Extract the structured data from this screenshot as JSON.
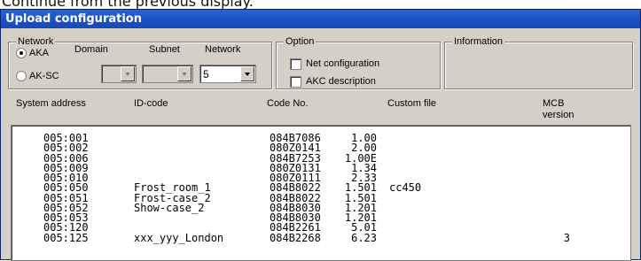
{
  "caption": "Continue from the previous display.",
  "window": {
    "title": "Upload configuration"
  },
  "network_group": {
    "title": "Network",
    "options": [
      {
        "label": "AKA",
        "selected": true
      },
      {
        "label": "AK-SC",
        "selected": false
      }
    ],
    "domain": {
      "label": "Domain",
      "value": ""
    },
    "subnet": {
      "label": "Subnet",
      "value": ""
    },
    "network": {
      "label": "Network",
      "value": "5"
    }
  },
  "option_group": {
    "title": "Option",
    "net_config": {
      "label": "Net configuration",
      "checked": false
    },
    "akc_desc": {
      "label": "AKC description",
      "checked": false
    }
  },
  "info_group": {
    "title": "Information"
  },
  "columns": {
    "system_address": "System address",
    "id_code": "ID-code",
    "code_no": "Code No.",
    "custom_file": "Custom file",
    "mcb_line1": "MCB",
    "mcb_line2": "version"
  },
  "rows": [
    {
      "addr": "005:001",
      "id": "",
      "code": "084B7086",
      "ver": "1.00",
      "custom": "",
      "mcb": ""
    },
    {
      "addr": "005:002",
      "id": "",
      "code": "080Z0141",
      "ver": "2.00",
      "custom": "",
      "mcb": ""
    },
    {
      "addr": "005:006",
      "id": "",
      "code": "084B7253",
      "ver": "1.00E",
      "custom": "",
      "mcb": ""
    },
    {
      "addr": "005:009",
      "id": "",
      "code": "080Z0131",
      "ver": "1.34",
      "custom": "",
      "mcb": ""
    },
    {
      "addr": "005:010",
      "id": "",
      "code": "080Z0111",
      "ver": "2.33",
      "custom": "",
      "mcb": ""
    },
    {
      "addr": "005:050",
      "id": "Frost_room_1",
      "code": "084B8022",
      "ver": "1.501",
      "custom": "cc450",
      "mcb": ""
    },
    {
      "addr": "005:051",
      "id": "Frost-case_2",
      "code": "084B8022",
      "ver": "1.501",
      "custom": "",
      "mcb": ""
    },
    {
      "addr": "005:052",
      "id": "Show-case_2",
      "code": "084B8030",
      "ver": "1.201",
      "custom": "",
      "mcb": ""
    },
    {
      "addr": "005:053",
      "id": "",
      "code": "084B8030",
      "ver": "1.201",
      "custom": "",
      "mcb": ""
    },
    {
      "addr": "005:120",
      "id": "",
      "code": "084B2261",
      "ver": "5.01",
      "custom": "",
      "mcb": ""
    },
    {
      "addr": "005:125",
      "id": "xxx_yyy_London",
      "code": "084B2268",
      "ver": "6.23",
      "custom": "",
      "mcb": "3"
    }
  ]
}
